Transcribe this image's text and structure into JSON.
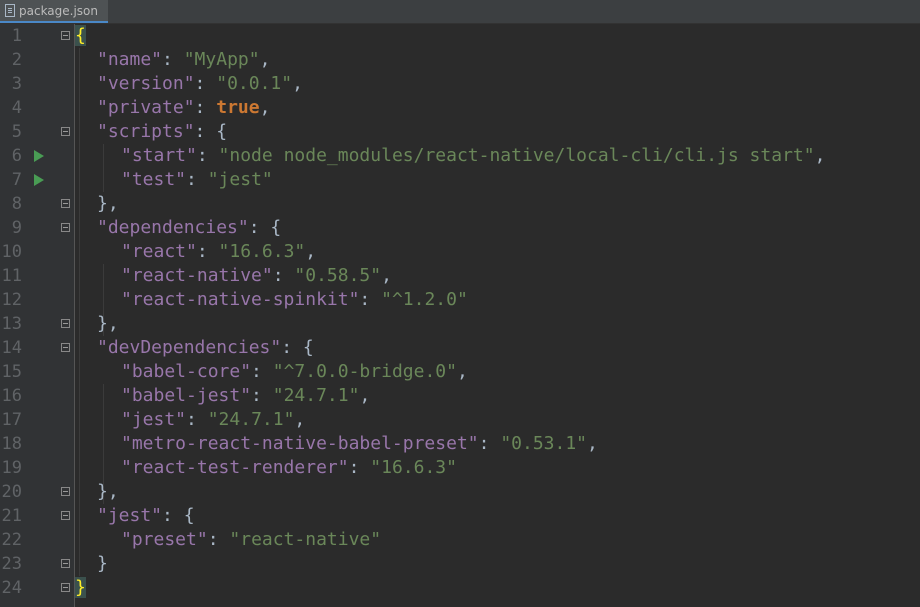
{
  "tab": {
    "filename": "package.json",
    "icon": "file-icon"
  },
  "line_numbers": [
    "1",
    "2",
    "3",
    "4",
    "5",
    "6",
    "7",
    "8",
    "9",
    "10",
    "11",
    "12",
    "13",
    "14",
    "15",
    "16",
    "17",
    "18",
    "19",
    "20",
    "21",
    "22",
    "23",
    "24"
  ],
  "code": {
    "l1": {
      "brace": "{"
    },
    "l2": {
      "key": "\"name\"",
      "colon": ": ",
      "val": "\"MyApp\"",
      "comma": ","
    },
    "l3": {
      "key": "\"version\"",
      "colon": ": ",
      "val": "\"0.0.1\"",
      "comma": ","
    },
    "l4": {
      "key": "\"private\"",
      "colon": ": ",
      "val": "true",
      "comma": ","
    },
    "l5": {
      "key": "\"scripts\"",
      "colon": ": {"
    },
    "l6": {
      "key": "\"start\"",
      "colon": ": ",
      "val": "\"node node_modules/react-native/local-cli/cli.js start\"",
      "comma": ","
    },
    "l7": {
      "key": "\"test\"",
      "colon": ": ",
      "val": "\"jest\""
    },
    "l8": {
      "text": "},"
    },
    "l9": {
      "key": "\"dependencies\"",
      "colon": ": {"
    },
    "l10": {
      "key": "\"react\"",
      "colon": ": ",
      "val": "\"16.6.3\"",
      "comma": ","
    },
    "l11": {
      "key": "\"react-native\"",
      "colon": ": ",
      "val": "\"0.58.5\"",
      "comma": ","
    },
    "l12": {
      "key": "\"react-native-spinkit\"",
      "colon": ": ",
      "val": "\"^1.2.0\""
    },
    "l13": {
      "text": "},"
    },
    "l14": {
      "key": "\"devDependencies\"",
      "colon": ": {"
    },
    "l15": {
      "key": "\"babel-core\"",
      "colon": ": ",
      "val": "\"^7.0.0-bridge.0\"",
      "comma": ","
    },
    "l16": {
      "key": "\"babel-jest\"",
      "colon": ": ",
      "val": "\"24.7.1\"",
      "comma": ","
    },
    "l17": {
      "key": "\"jest\"",
      "colon": ": ",
      "val": "\"24.7.1\"",
      "comma": ","
    },
    "l18": {
      "key": "\"metro-react-native-babel-preset\"",
      "colon": ": ",
      "val": "\"0.53.1\"",
      "comma": ","
    },
    "l19": {
      "key": "\"react-test-renderer\"",
      "colon": ": ",
      "val": "\"16.6.3\""
    },
    "l20": {
      "text": "},"
    },
    "l21": {
      "key": "\"jest\"",
      "colon": ": {"
    },
    "l22": {
      "key": "\"preset\"",
      "colon": ": ",
      "val": "\"react-native\""
    },
    "l23": {
      "text": "}"
    },
    "l24": {
      "brace": "}"
    }
  },
  "colors": {
    "background": "#2b2b2b",
    "gutter": "#313335",
    "key": "#9876aa",
    "string": "#6a8759",
    "keyword": "#cc7832",
    "punctuation": "#a9b7c6",
    "line_number": "#606366",
    "matched_brace": "#ffef28",
    "run_icon": "#499c54"
  }
}
